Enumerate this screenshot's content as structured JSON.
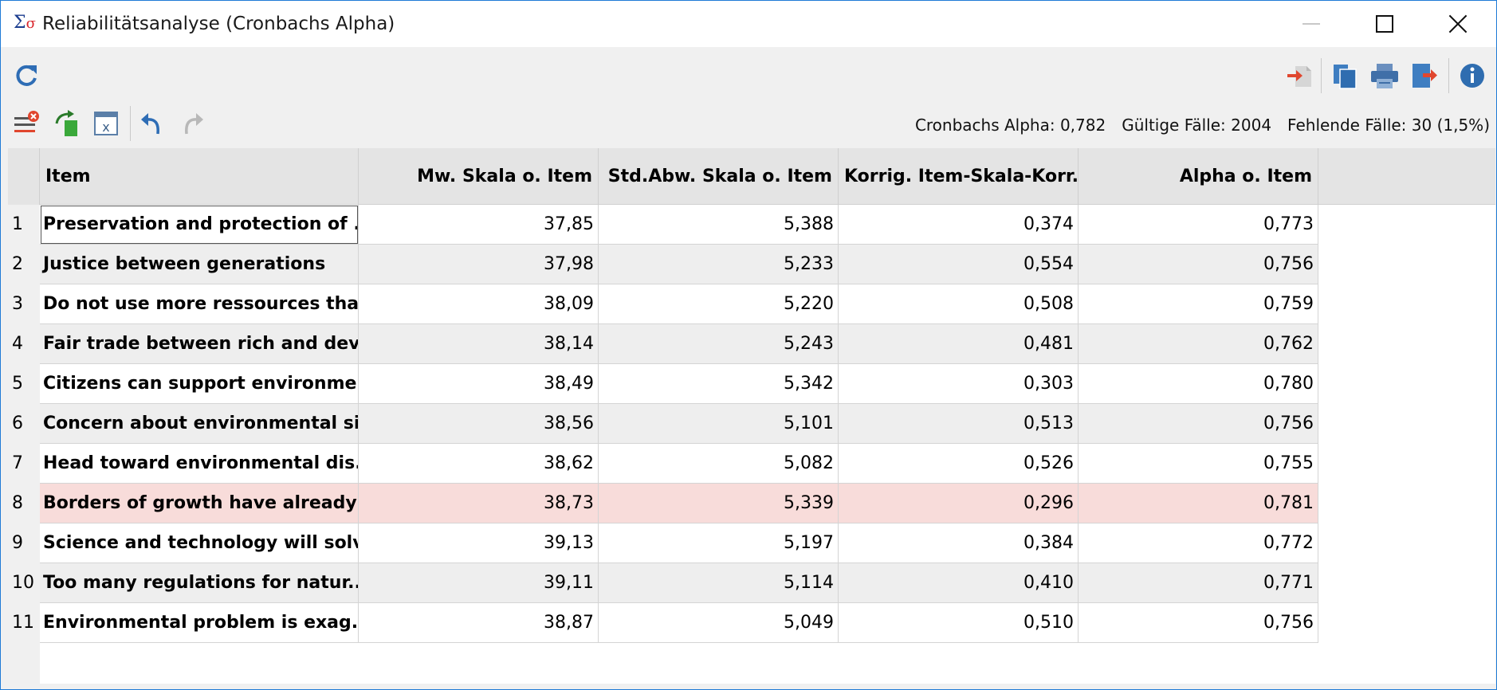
{
  "window": {
    "title": "Reliabilitätsanalyse (Cronbachs Alpha)"
  },
  "toolbar": {
    "refresh_icon": "refresh-icon",
    "right_icons": [
      "export-doc-icon",
      "copy-icon",
      "print-icon",
      "export-icon",
      "info-icon"
    ],
    "second_row_icons": [
      "remove-items-icon",
      "recycle-icon",
      "excel-icon",
      "undo-icon",
      "redo-icon"
    ]
  },
  "stats": {
    "alpha": "Cronbachs Alpha: 0,782",
    "valid": "Gültige Fälle: 2004",
    "missing": "Fehlende Fälle: 30 (1,5%)"
  },
  "table": {
    "headers": {
      "item": "Item",
      "mw": "Mw. Skala o. Item",
      "sd": "Std.Abw. Skala o. Item",
      "korr": "Korrig. Item-Skala-Korr.",
      "alpha": "Alpha o. Item"
    },
    "rows": [
      {
        "n": "1",
        "item": "Preservation and protection of ...",
        "mw": "37,85",
        "sd": "5,388",
        "korr": "0,374",
        "alpha": "0,773"
      },
      {
        "n": "2",
        "item": "Justice between generations",
        "mw": "37,98",
        "sd": "5,233",
        "korr": "0,554",
        "alpha": "0,756"
      },
      {
        "n": "3",
        "item": "Do not use more ressources tha...",
        "mw": "38,09",
        "sd": "5,220",
        "korr": "0,508",
        "alpha": "0,759"
      },
      {
        "n": "4",
        "item": "Fair trade between rich and dev...",
        "mw": "38,14",
        "sd": "5,243",
        "korr": "0,481",
        "alpha": "0,762"
      },
      {
        "n": "5",
        "item": "Citizens can support environme...",
        "mw": "38,49",
        "sd": "5,342",
        "korr": "0,303",
        "alpha": "0,780"
      },
      {
        "n": "6",
        "item": "Concern about environmental si...",
        "mw": "38,56",
        "sd": "5,101",
        "korr": "0,513",
        "alpha": "0,756"
      },
      {
        "n": "7",
        "item": "Head toward environmental dis...",
        "mw": "38,62",
        "sd": "5,082",
        "korr": "0,526",
        "alpha": "0,755"
      },
      {
        "n": "8",
        "item": "Borders of growth have already cr",
        "mw": "38,73",
        "sd": "5,339",
        "korr": "0,296",
        "alpha": "0,781"
      },
      {
        "n": "9",
        "item": "Science and technology will solv...",
        "mw": "39,13",
        "sd": "5,197",
        "korr": "0,384",
        "alpha": "0,772"
      },
      {
        "n": "10",
        "item": "Too many regulations for natur...",
        "mw": "39,11",
        "sd": "5,114",
        "korr": "0,410",
        "alpha": "0,771"
      },
      {
        "n": "11",
        "item": "Environmental problem is exag...",
        "mw": "38,87",
        "sd": "5,049",
        "korr": "0,510",
        "alpha": "0,756"
      }
    ],
    "highlight_color": "#f8dcda"
  }
}
